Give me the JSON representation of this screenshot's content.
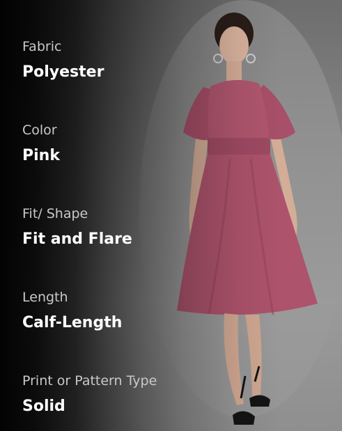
{
  "colors": {
    "background": "#8a8a8a",
    "overlay": "#000000",
    "label": "#c9c9c9",
    "value": "#ffffff",
    "dress": "#b0566f"
  },
  "product_photo": {
    "icon": "dress-model-image"
  },
  "attributes": [
    {
      "label": "Fabric",
      "value": "Polyester"
    },
    {
      "label": "Color",
      "value": "Pink"
    },
    {
      "label": "Fit/ Shape",
      "value": "Fit and Flare"
    },
    {
      "label": "Length",
      "value": "Calf-Length"
    },
    {
      "label": "Print or Pattern Type",
      "value": "Solid"
    }
  ]
}
